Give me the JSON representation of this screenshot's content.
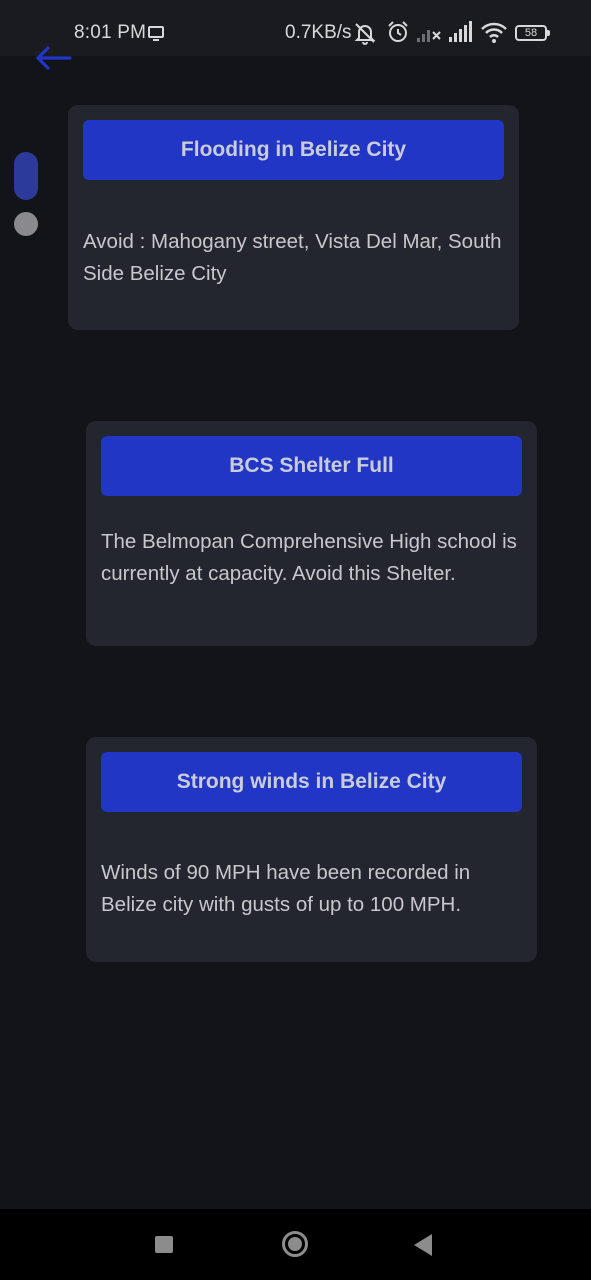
{
  "status_bar": {
    "time": "8:01 PM",
    "network_speed": "0.7KB/s",
    "battery_level": "58",
    "icons": [
      "screen-cast-icon",
      "muted-bell-icon",
      "alarm-icon",
      "signal-no-service-icon",
      "signal-icon",
      "wifi-icon",
      "battery-icon"
    ]
  },
  "header": {
    "back_icon": "arrow-left-icon"
  },
  "pager": {
    "active_index": 0,
    "count": 2
  },
  "alerts": [
    {
      "title": "Flooding in Belize City",
      "body": "Avoid : Mahogany street, Vista Del Mar, South Side Belize City"
    },
    {
      "title": "BCS Shelter Full",
      "body": "The Belmopan Comprehensive High school is currently at capacity. Avoid this Shelter."
    },
    {
      "title": "Strong winds in Belize City",
      "body": "Winds of 90 MPH have been recorded in Belize city with gusts of up to 100 MPH."
    }
  ],
  "colors": {
    "background": "#131419",
    "card": "#24262f",
    "title_bar": "#2136c4",
    "accent": "#2c3a9c"
  },
  "nav_bar": {
    "icons": [
      "recent-apps-icon",
      "home-icon",
      "back-icon"
    ]
  }
}
